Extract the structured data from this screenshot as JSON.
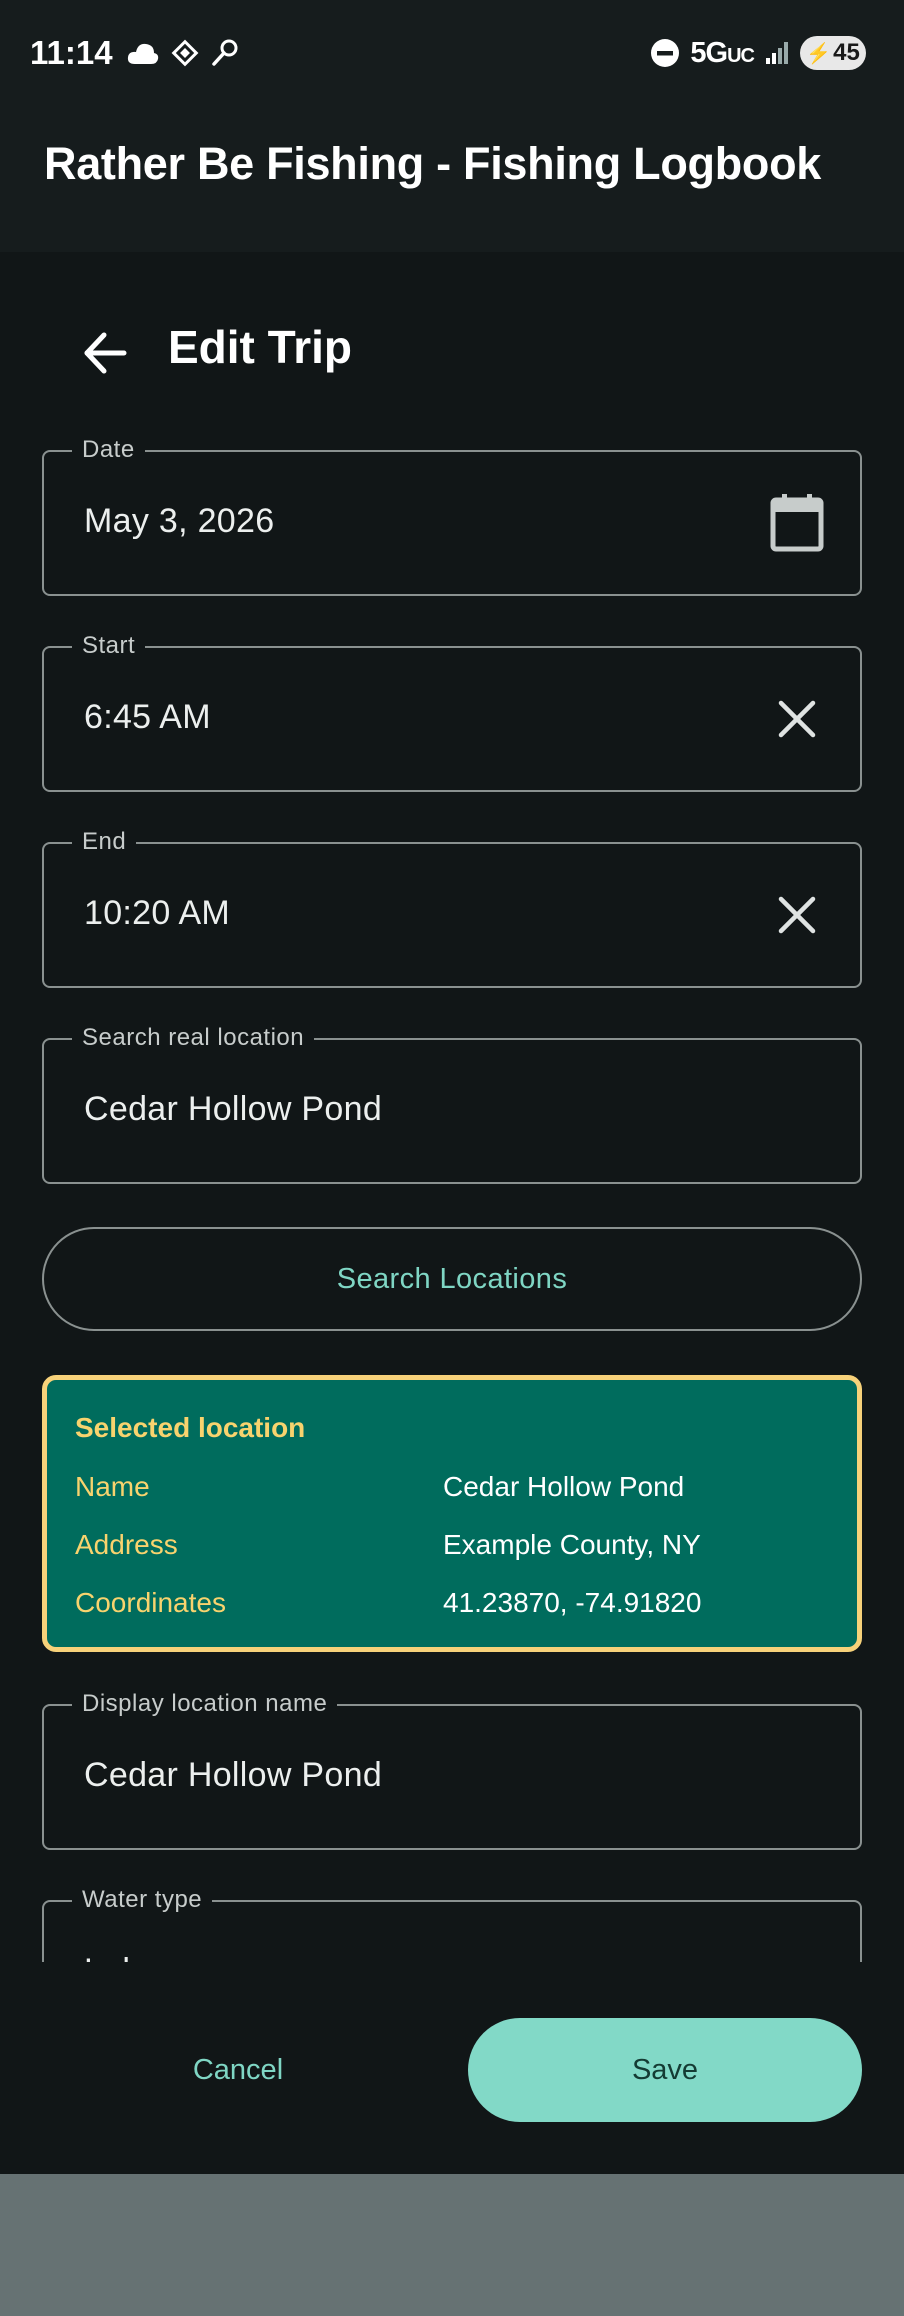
{
  "status_bar": {
    "time": "11:14",
    "network": "5G",
    "network_suffix": "UC",
    "battery": "45",
    "icons": [
      "cloud-icon",
      "diamond-icon",
      "brush-icon",
      "do-not-disturb-icon",
      "signal-icon",
      "battery-charging-icon"
    ]
  },
  "app_bar": {
    "title": "Rather Be Fishing - Fishing Logbook"
  },
  "header": {
    "title": "Edit Trip",
    "back_icon": "arrow-back-icon"
  },
  "fields": {
    "date": {
      "label": "Date",
      "value": "May 3, 2026",
      "trailing_icon": "calendar-icon"
    },
    "start": {
      "label": "Start",
      "value": "6:45 AM",
      "trailing_icon": "clear-icon"
    },
    "end": {
      "label": "End",
      "value": "10:20 AM",
      "trailing_icon": "clear-icon"
    },
    "search_location": {
      "label": "Search real location",
      "value": "Cedar Hollow Pond"
    },
    "display_name": {
      "label": "Display location name",
      "value": "Cedar Hollow Pond"
    },
    "water_type": {
      "label": "Water type",
      "value": "Lake"
    }
  },
  "search_button": {
    "label": "Search Locations"
  },
  "selected_location": {
    "heading": "Selected location",
    "rows": [
      {
        "key": "Name",
        "value": "Cedar Hollow Pond"
      },
      {
        "key": "Address",
        "value": "Example County, NY"
      },
      {
        "key": "Coordinates",
        "value": "41.23870, -74.91820"
      }
    ]
  },
  "actions": {
    "cancel": "Cancel",
    "save": "Save"
  },
  "colors": {
    "background": "#111617",
    "accent": "#82d9c7",
    "card": "#006c5d",
    "card_border": "#f7d27a",
    "card_key": "#f8d36e"
  }
}
